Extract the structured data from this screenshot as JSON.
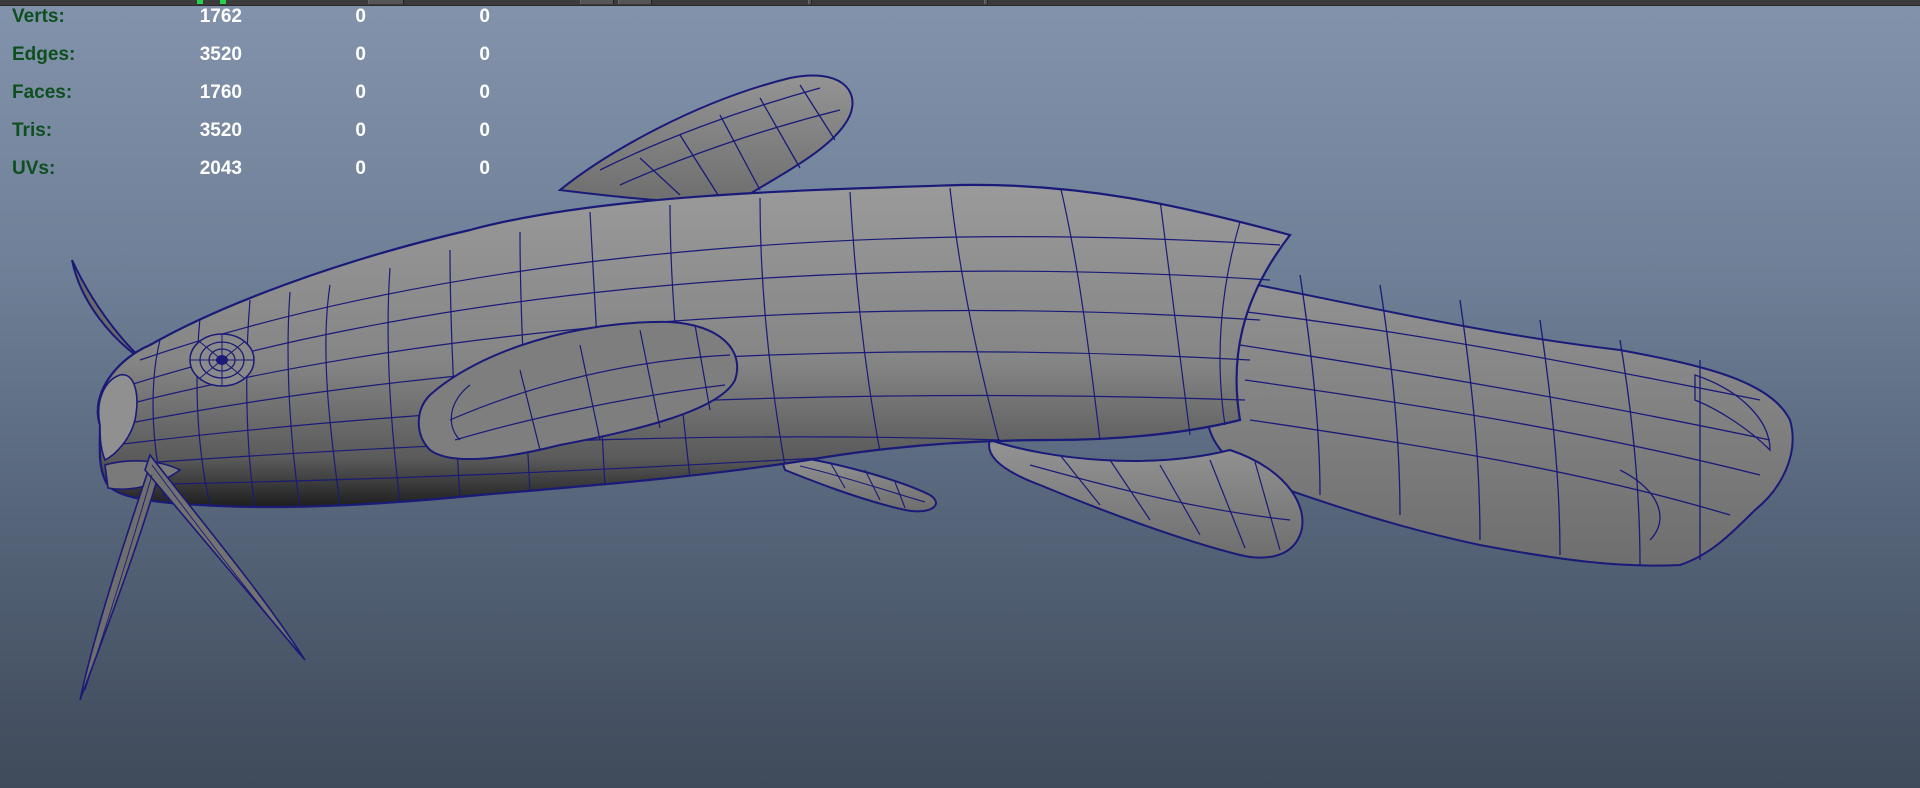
{
  "hud": {
    "rows": [
      {
        "label": "Verts:",
        "values": [
          "1762",
          "0",
          "0"
        ]
      },
      {
        "label": "Edges:",
        "values": [
          "3520",
          "0",
          "0"
        ]
      },
      {
        "label": "Faces:",
        "values": [
          "1760",
          "0",
          "0"
        ]
      },
      {
        "label": "Tris:",
        "values": [
          "3520",
          "0",
          "0"
        ]
      },
      {
        "label": "UVs:",
        "values": [
          "2043",
          "0",
          "0"
        ]
      }
    ]
  },
  "colors": {
    "hud_label": "#0d4f1f",
    "hud_value": "#ffffff",
    "wireframe": "#1a1a78",
    "mesh_fill": "#8a8a8a",
    "viewport_top": "#8293ab",
    "viewport_bottom": "#3f4a5a"
  },
  "scene": {
    "object": "catfish-mesh",
    "display_mode": "wireframe-on-shaded"
  }
}
